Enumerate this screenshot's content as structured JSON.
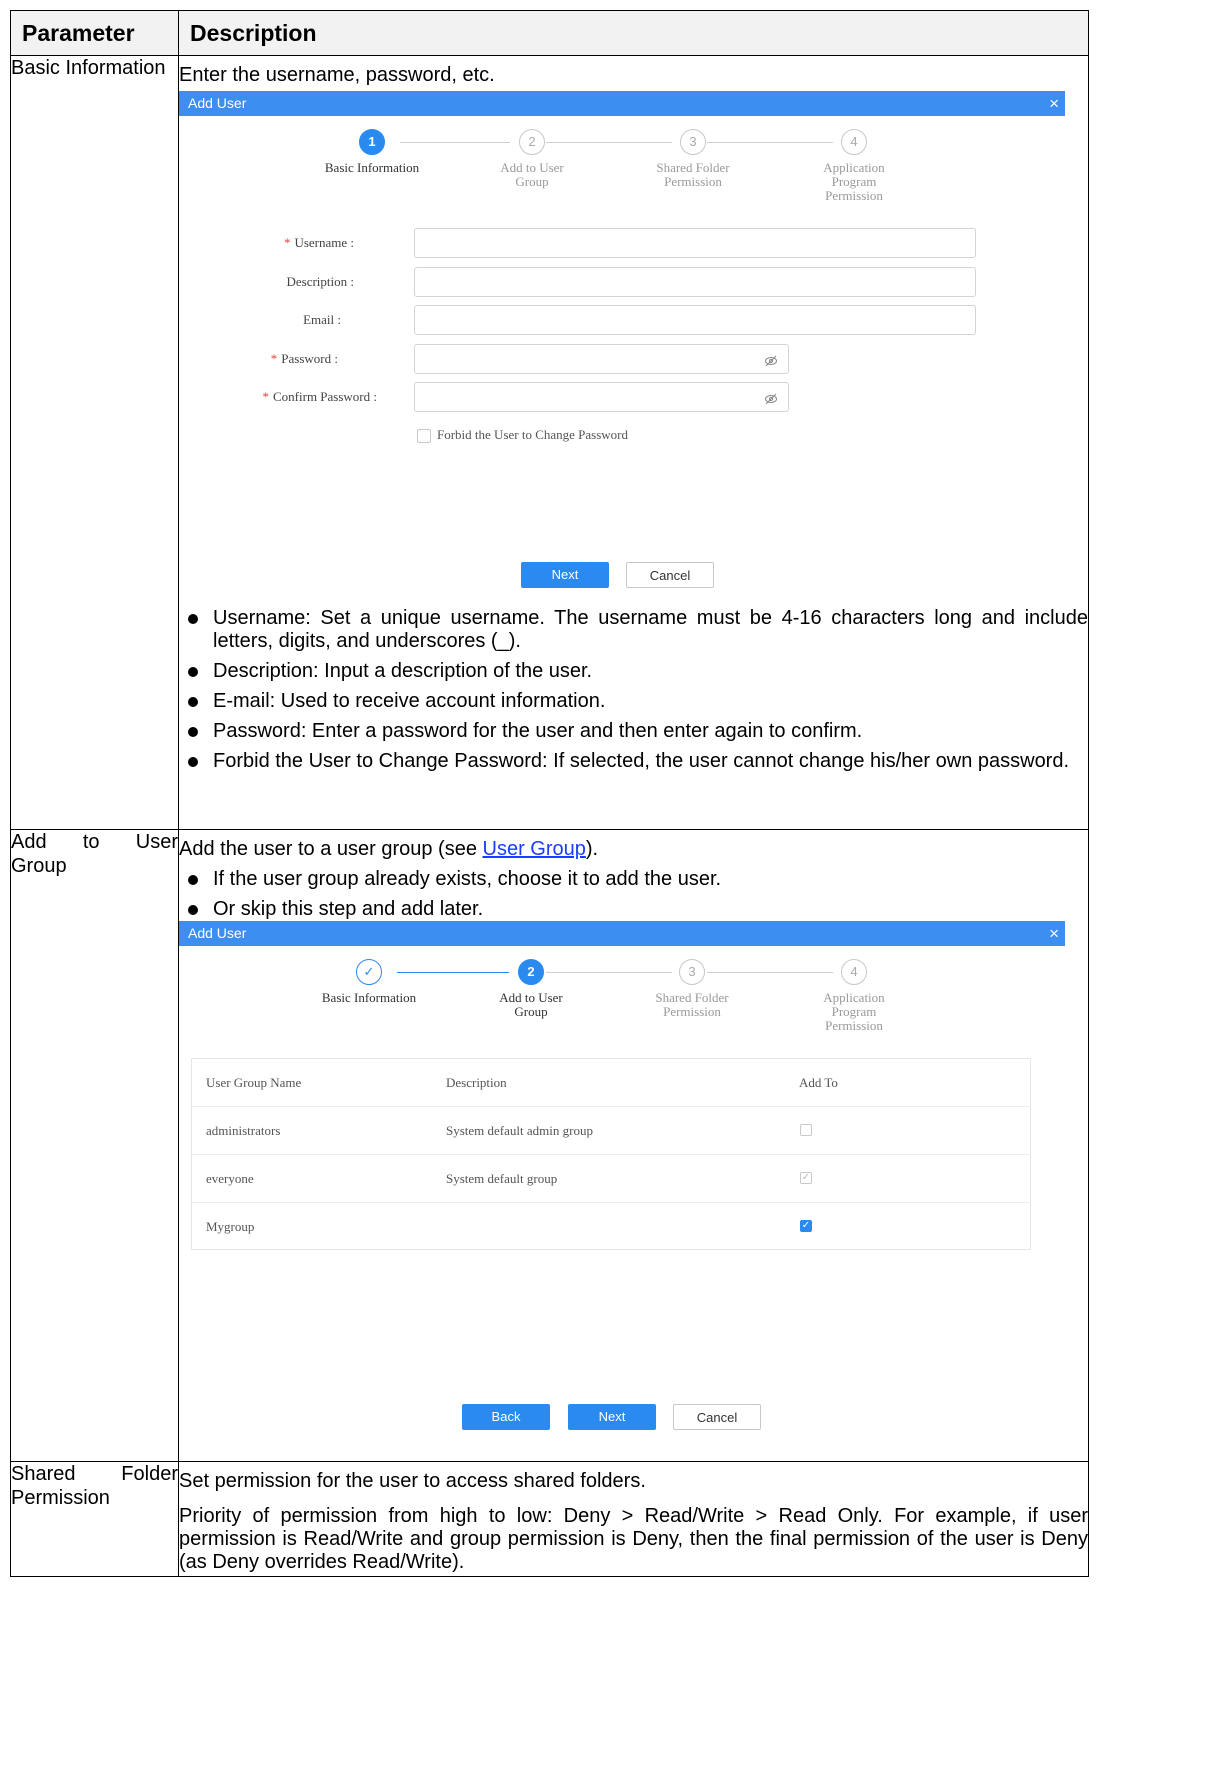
{
  "table": {
    "header_param": "Parameter",
    "header_desc": "Description"
  },
  "row1": {
    "param": "Basic Information",
    "intro": "Enter the username, password, etc.",
    "bullets": [
      "Username: Set a unique username. The username must be 4-16 characters long and include letters, digits, and underscores (_).",
      "Description: Input a description of the user.",
      "E-mail: Used to receive account information.",
      "Password: Enter a password for the user and then enter again to confirm.",
      "Forbid the User to Change Password: If selected, the user cannot change his/her own password."
    ]
  },
  "dialog1": {
    "title": "Add User",
    "close": "×",
    "steps": [
      {
        "num": "1",
        "label": "Basic Information"
      },
      {
        "num": "2",
        "label": "Add to User Group"
      },
      {
        "num": "3",
        "label": "Shared Folder Permission"
      },
      {
        "num": "4",
        "label": "Application Program Permission"
      }
    ],
    "fields": {
      "username": "Username :",
      "description": "Description :",
      "email": "Email :",
      "password": "Password :",
      "confirm": "Confirm Password :"
    },
    "required_mark": "*",
    "eye_icon": "eye-off-icon",
    "checkbox_label": "Forbid the User to Change Password",
    "next": "Next",
    "cancel": "Cancel"
  },
  "row2": {
    "param_a": "Add",
    "param_b": "to",
    "param_c": "User",
    "param_d": "Group",
    "intro_before": "Add the user to a user group (see ",
    "intro_link": "User Group",
    "intro_after": ").",
    "bullets": [
      "If the user group already exists, choose it to add the user.",
      "Or skip this step and add later."
    ]
  },
  "dialog2": {
    "title": "Add User",
    "close": "×",
    "steps": [
      {
        "num": "✓",
        "label": "Basic Information"
      },
      {
        "num": "2",
        "label": "Add to User Group"
      },
      {
        "num": "3",
        "label": "Shared Folder Permission"
      },
      {
        "num": "4",
        "label": "Application Program Permission"
      }
    ],
    "columns": [
      "User Group Name",
      "Description",
      "Add To"
    ],
    "groups": [
      {
        "name": "administrators",
        "desc": "System default admin group",
        "checked": false
      },
      {
        "name": "everyone",
        "desc": "System default group",
        "checked": true
      },
      {
        "name": "Mygroup",
        "desc": "",
        "checked": true
      }
    ],
    "back": "Back",
    "next": "Next",
    "cancel": "Cancel"
  },
  "row3": {
    "param_a": "Shared",
    "param_b": "Folder",
    "param_c": "Permission",
    "intro": "Set permission for the user to access shared folders.",
    "para": "Priority of permission from high to low: Deny > Read/Write > Read Only. For example, if user permission is Read/Write and group permission is Deny, then the final permission of the user is Deny (as Deny overrides Read/Write)."
  },
  "colors": {
    "accent": "#2a8af0",
    "titlebar": "#3c8ff0",
    "required": "#e8403c",
    "link": "#1a3cff"
  }
}
